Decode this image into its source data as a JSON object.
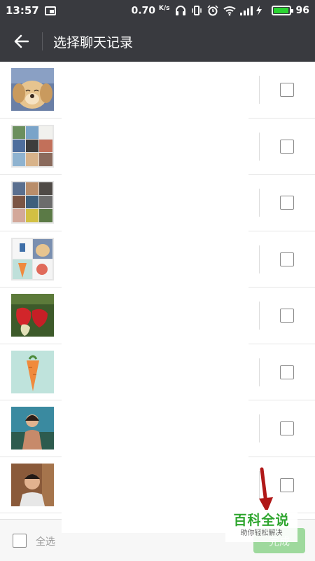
{
  "status_bar": {
    "time": "13:57",
    "net_speed": "0.70",
    "net_speed_unit": "K/s",
    "battery_level": "96",
    "battery_fraction": 0.96
  },
  "header": {
    "back_icon": "back-arrow-icon",
    "title": "选择聊天记录"
  },
  "chats": [
    {
      "avatar": "puppy-avatar"
    },
    {
      "avatar": "group-grid-avatar-1"
    },
    {
      "avatar": "group-grid-avatar-2"
    },
    {
      "avatar": "puppy-carrot-grid-avatar"
    },
    {
      "avatar": "strawberry-avatar"
    },
    {
      "avatar": "carrot-avatar"
    },
    {
      "avatar": "woman-portrait-avatar"
    },
    {
      "avatar": "man-portrait-avatar"
    }
  ],
  "bottom_bar": {
    "select_all_label": "全选",
    "done_label": "完成"
  },
  "watermark": {
    "title": "百科全说",
    "subtitle": "助你轻松解决"
  },
  "colors": {
    "header_bg": "#393a3f",
    "done_button": "#9ed99d",
    "watermark_green": "#2ea52e",
    "arrow_red": "#b01818"
  }
}
